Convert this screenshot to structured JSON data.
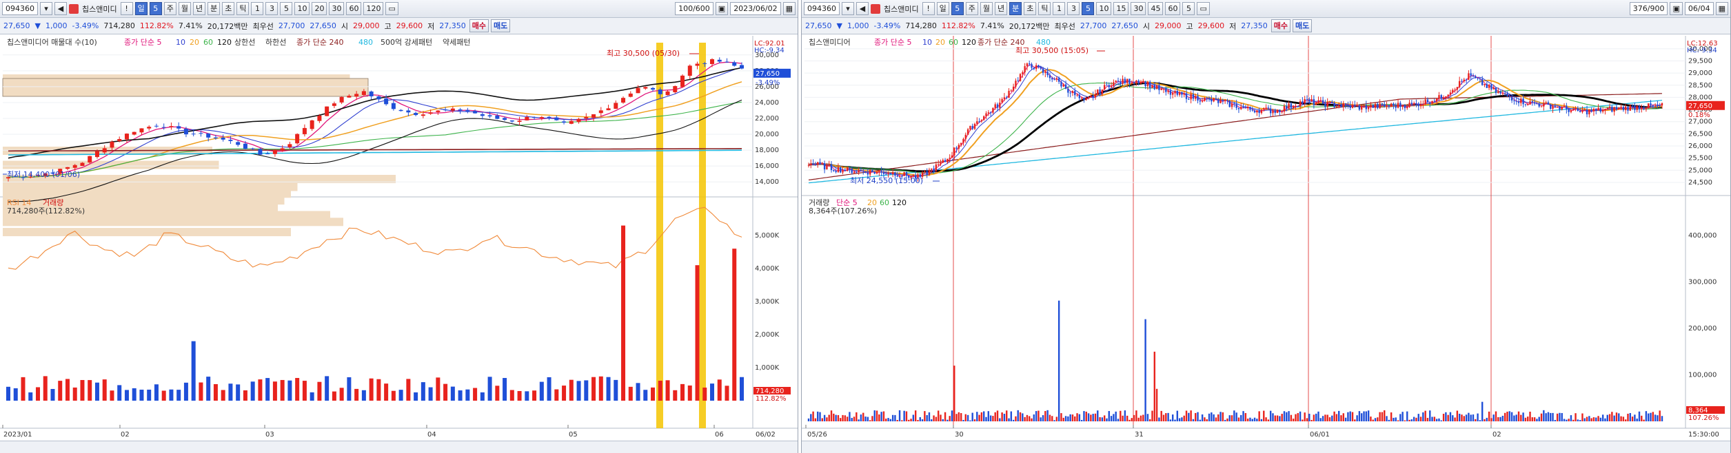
{
  "left": {
    "toolbar": {
      "code": "094360",
      "name": "칩스앤미디",
      "periods": [
        "일",
        "5",
        "주",
        "월",
        "년",
        "분",
        "초",
        "틱"
      ],
      "minute_steps": [
        "1",
        "3",
        "5",
        "10",
        "20",
        "30",
        "60",
        "120"
      ],
      "count": "100/600",
      "date": "2023/06/02"
    },
    "quote": {
      "price": "27,650",
      "change": "1,000",
      "pct": "-3.49%",
      "volume": "714,280",
      "vol_ratio": "112.82%",
      "turnover": "7.41%",
      "amount": "20,172백만",
      "best_label": "최우선",
      "best_ask": "27,700",
      "best_bid": "27,650",
      "open_label": "시",
      "open": "29,000",
      "high_label": "고",
      "high": "29,600",
      "low_label": "저",
      "low": "27,350",
      "buy": "매수",
      "sell": "매도"
    },
    "legend": {
      "name": "칩스앤미디어 매물대 수(10)",
      "ma_label": "종가 단순 5",
      "ma_periods": [
        "10",
        "20",
        "60",
        "120"
      ],
      "upper": "상한선",
      "lower": "하한선",
      "long_label": "종가 단순 240",
      "long2": "480",
      "strong": "500억 강세패턴",
      "weak": "약세패턴"
    },
    "annotations": {
      "high": "최고 30,500 (05/30)",
      "low": "최저 14,400 (01/06)"
    },
    "axis": {
      "price_ticks": [
        "30,000",
        "28,000",
        "26,000",
        "24,000",
        "22,000",
        "20,000",
        "18,000",
        "16,000",
        "14,000"
      ],
      "lc": "LC:92.01",
      "hc": "HC:-9.34",
      "cur_price": "27,650",
      "cur_pct": "-3.49%",
      "vol_ticks": [
        "5,000K",
        "4,000K",
        "3,000K",
        "2,000K",
        "1,000K"
      ],
      "cur_vol": "714,280",
      "cur_vol_pct": "112.82%",
      "months": [
        "2023/01",
        "02",
        "03",
        "04",
        "05",
        "06"
      ],
      "last_date": "06/02"
    },
    "sub_legend": {
      "rsi": "RSI 14",
      "vol": "거래량",
      "vol_value": "714,280주(112.82%)"
    }
  },
  "right": {
    "toolbar": {
      "code": "094360",
      "name": "칩스앤미디",
      "periods": [
        "일",
        "5",
        "주",
        "월",
        "년",
        "분",
        "초",
        "틱"
      ],
      "minute_steps": [
        "1",
        "3",
        "5",
        "10",
        "15",
        "30",
        "45",
        "60",
        "5"
      ],
      "count": "376/900",
      "date": "06/04"
    },
    "quote": {
      "price": "27,650",
      "change": "1,000",
      "pct": "-3.49%",
      "volume": "714,280",
      "vol_ratio": "112.82%",
      "turnover": "7.41%",
      "amount": "20,172백만",
      "best_label": "최우선",
      "best_ask": "27,700",
      "best_bid": "27,650",
      "open_label": "시",
      "open": "29,000",
      "high_label": "고",
      "high": "29,600",
      "low_label": "저",
      "low": "27,350",
      "buy": "매수",
      "sell": "매도"
    },
    "legend": {
      "name": "칩스앤미디어",
      "ma_label": "종가 단순 5",
      "ma_periods": [
        "10",
        "20",
        "60",
        "120"
      ],
      "long_label": "종가 단순 240",
      "long2": "480"
    },
    "annotations": {
      "high": "최고 30,500 (15:05)",
      "low": "최저 24,550 (15:00)"
    },
    "axis": {
      "price_ticks": [
        "30,000",
        "29,500",
        "29,000",
        "28,500",
        "28,000",
        "27,500",
        "27,000",
        "26,500",
        "26,000",
        "25,500",
        "25,000",
        "24,500"
      ],
      "lc": "LC:12.63",
      "hc": "HC:-9.34",
      "cur_price": "27,650",
      "cur_pct": "0.18%",
      "vol_ticks": [
        "400,000",
        "300,000",
        "200,000",
        "100,000"
      ],
      "cur_vol": "8,364",
      "cur_vol_pct": "107.26%",
      "days": [
        "05/26",
        "30",
        "31",
        "06/01",
        "02"
      ],
      "last_time": "15:30:00"
    },
    "sub_legend": {
      "vol": "거래량",
      "ma_label": "단순 5",
      "periods": [
        "20",
        "60",
        "120"
      ],
      "vol_value": "8,364주(107.26%)"
    }
  },
  "colors": {
    "up": "#e8231d",
    "down": "#1f4fd8",
    "ma5": "#e0157a",
    "ma10": "#2f3fd0",
    "ma20": "#f0a020",
    "ma60": "#3cb34a",
    "ma120": "#111111",
    "ma240": "#8b1d1d",
    "ma480": "#20b8e0",
    "volume_profile": "#f1dcc2",
    "highlight": "#f5c400",
    "rsi": "#f08a3a"
  }
}
